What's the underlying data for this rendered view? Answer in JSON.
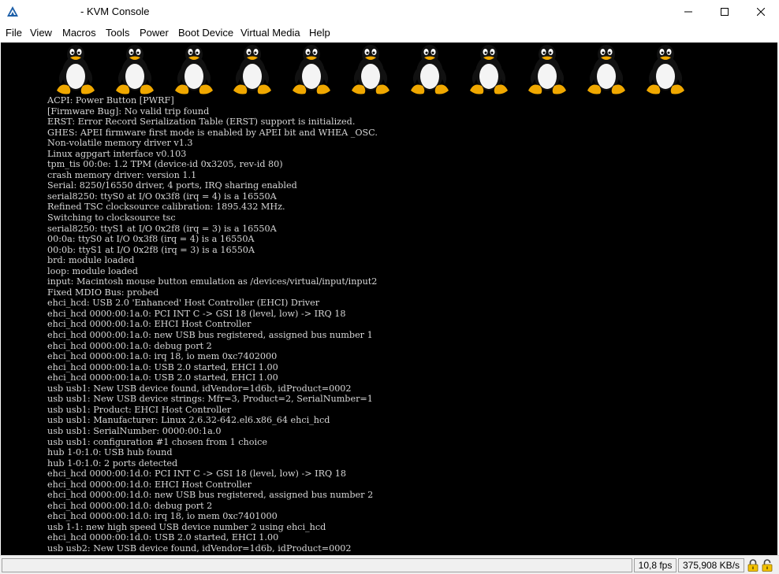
{
  "window": {
    "title": "- KVM Console",
    "icon": "kvm-app-icon"
  },
  "menu": [
    "File",
    "View",
    "Macros",
    "Tools",
    "Power",
    "Boot Device",
    "Virtual Media",
    "Help"
  ],
  "console": {
    "boot_logo_count": 11,
    "lines": [
      "ACPI: Power Button [PWRF]",
      "[Firmware Bug]: No valid trip found",
      "ERST: Error Record Serialization Table (ERST) support is initialized.",
      "GHES: APEI firmware first mode is enabled by APEI bit and WHEA _OSC.",
      "Non-volatile memory driver v1.3",
      "Linux agpgart interface v0.103",
      "tpm_tis 00:0e: 1.2 TPM (device-id 0x3205, rev-id 80)",
      "crash memory driver: version 1.1",
      "Serial: 8250/16550 driver, 4 ports, IRQ sharing enabled",
      "serial8250: ttyS0 at I/O 0x3f8 (irq = 4) is a 16550A",
      "Refined TSC clocksource calibration: 1895.432 MHz.",
      "Switching to clocksource tsc",
      "serial8250: ttyS1 at I/O 0x2f8 (irq = 3) is a 16550A",
      "00:0a: ttyS0 at I/O 0x3f8 (irq = 4) is a 16550A",
      "00:0b: ttyS1 at I/O 0x2f8 (irq = 3) is a 16550A",
      "brd: module loaded",
      "loop: module loaded",
      "input: Macintosh mouse button emulation as /devices/virtual/input/input2",
      "Fixed MDIO Bus: probed",
      "ehci_hcd: USB 2.0 'Enhanced' Host Controller (EHCI) Driver",
      "ehci_hcd 0000:00:1a.0: PCI INT C -> GSI 18 (level, low) -> IRQ 18",
      "ehci_hcd 0000:00:1a.0: EHCI Host Controller",
      "ehci_hcd 0000:00:1a.0: new USB bus registered, assigned bus number 1",
      "ehci_hcd 0000:00:1a.0: debug port 2",
      "ehci_hcd 0000:00:1a.0: irq 18, io mem 0xc7402000",
      "ehci_hcd 0000:00:1a.0: USB 2.0 started, EHCI 1.00",
      "ehci_hcd 0000:00:1a.0: USB 2.0 started, EHCI 1.00",
      "usb usb1: New USB device found, idVendor=1d6b, idProduct=0002",
      "usb usb1: New USB device strings: Mfr=3, Product=2, SerialNumber=1",
      "usb usb1: Product: EHCI Host Controller",
      "usb usb1: Manufacturer: Linux 2.6.32-642.el6.x86_64 ehci_hcd",
      "usb usb1: SerialNumber: 0000:00:1a.0",
      "usb usb1: configuration #1 chosen from 1 choice",
      "hub 1-0:1.0: USB hub found",
      "hub 1-0:1.0: 2 ports detected",
      "ehci_hcd 0000:00:1d.0: PCI INT C -> GSI 18 (level, low) -> IRQ 18",
      "ehci_hcd 0000:00:1d.0: EHCI Host Controller",
      "ehci_hcd 0000:00:1d.0: new USB bus registered, assigned bus number 2",
      "ehci_hcd 0000:00:1d.0: debug port 2",
      "ehci_hcd 0000:00:1d.0: irq 18, io mem 0xc7401000",
      "usb 1-1: new high speed USB device number 2 using ehci_hcd",
      "ehci_hcd 0000:00:1d.0: USB 2.0 started, EHCI 1.00",
      "usb usb2: New USB device found, idVendor=1d6b, idProduct=0002"
    ]
  },
  "status": {
    "fps": "10,8 fps",
    "throughput": "375,908 KB/s",
    "lock_icon_1": "padlock-icon",
    "lock_icon_2": "padlock-icon"
  },
  "colors": {
    "console_bg": "#000000",
    "console_text": "#d6d6d6",
    "penguin_beak": "#f0a800"
  }
}
